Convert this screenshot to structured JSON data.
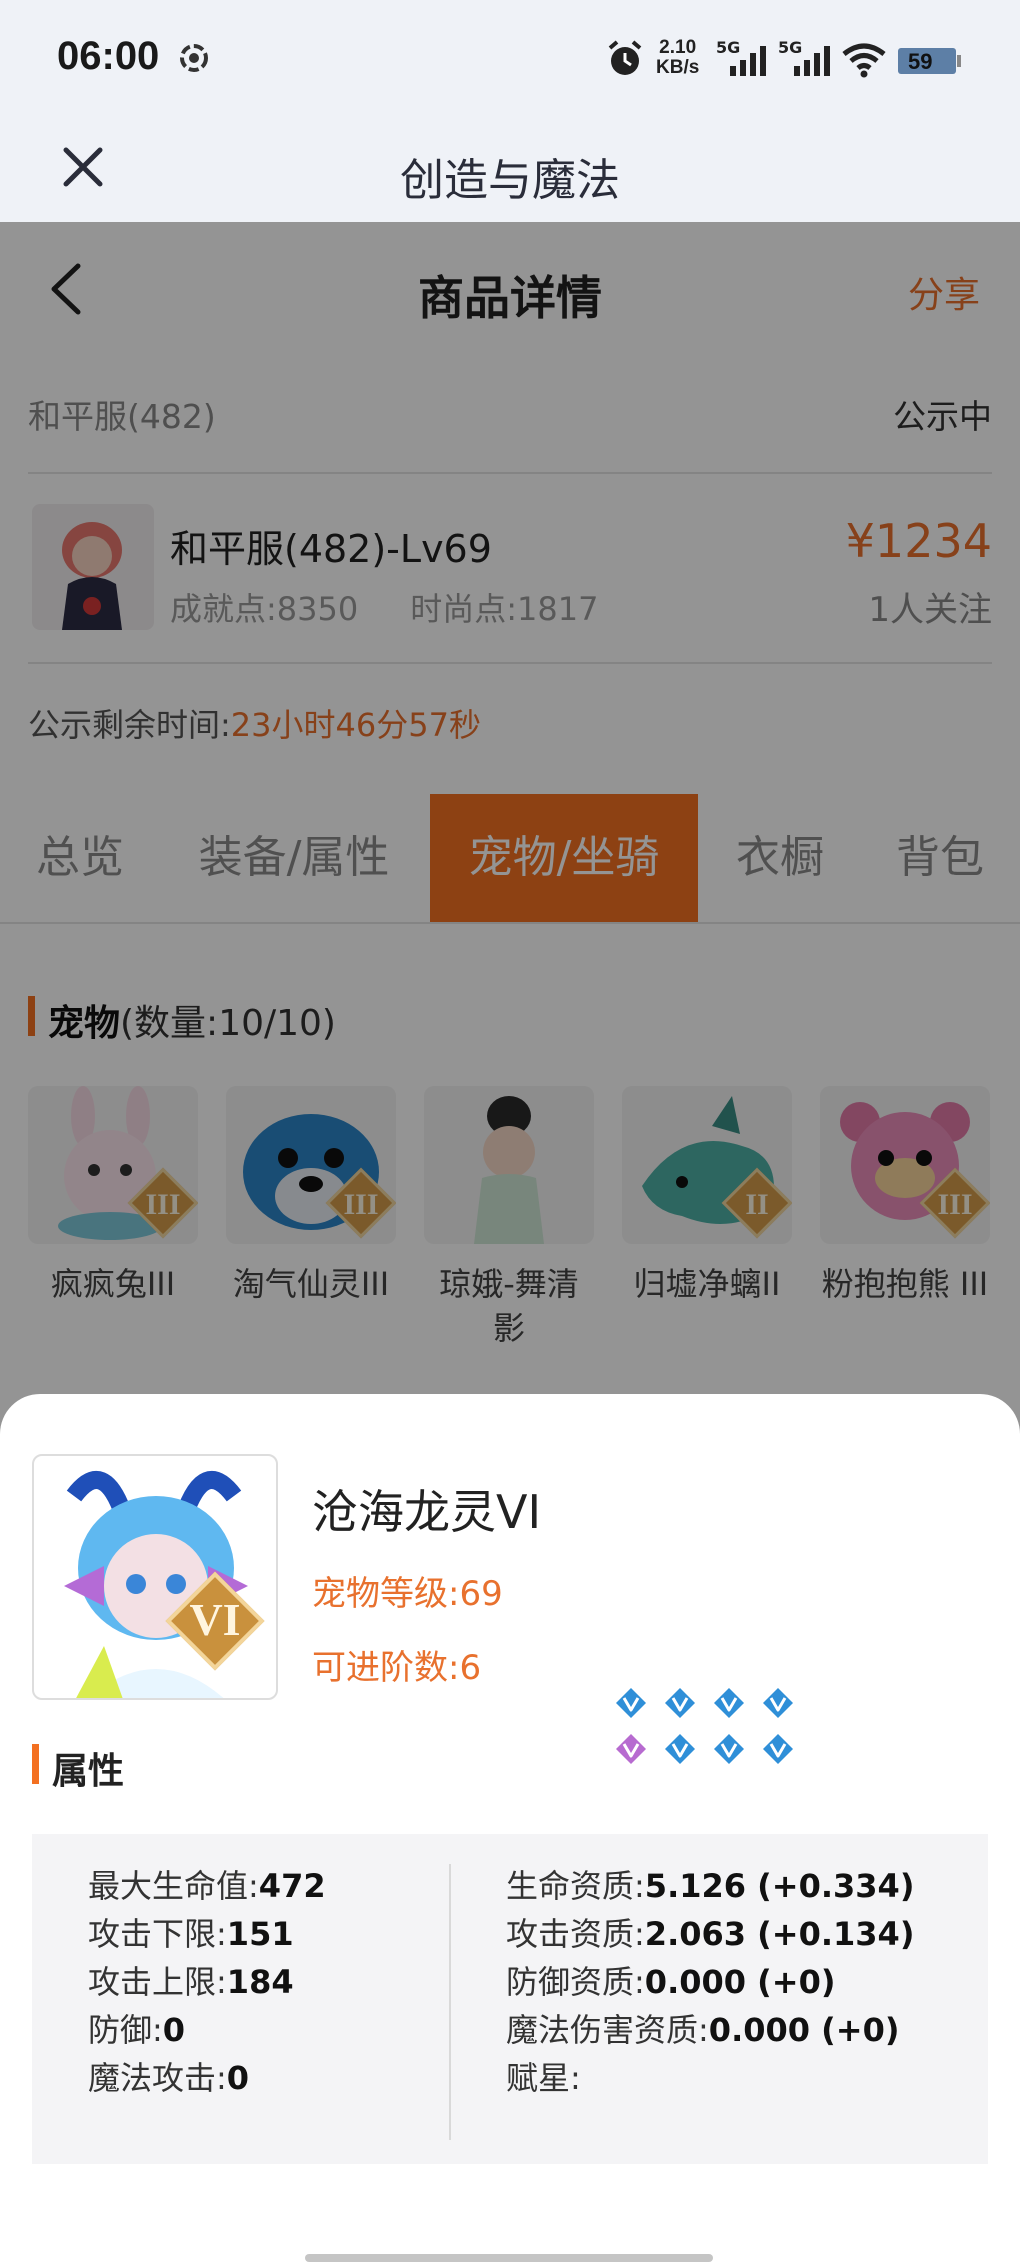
{
  "status_bar": {
    "time": "06:00",
    "net_speed_top": "2.10",
    "net_speed_unit": "KB/s",
    "sim1": "5G",
    "sim2": "5G",
    "battery": "59"
  },
  "app_bar": {
    "title": "创造与魔法",
    "close_icon": "close-icon"
  },
  "nav": {
    "title": "商品详情",
    "share": "分享",
    "back_icon": "chevron-left-icon"
  },
  "listing": {
    "server": "和平服(482)",
    "status": "公示中",
    "character_name": "和平服(482)-Lv69",
    "achievement": "成就点:8350",
    "fashion": "时尚点:1817",
    "price": "¥1234",
    "followers": "1人关注",
    "countdown_label": "公示剩余时间:",
    "countdown_value": "23小时46分57秒"
  },
  "tabs": [
    {
      "label": "总览",
      "active": false
    },
    {
      "label": "装备/属性",
      "active": false
    },
    {
      "label": "宠物/坐骑",
      "active": true
    },
    {
      "label": "衣橱",
      "active": false
    },
    {
      "label": "背包",
      "active": false
    }
  ],
  "pets_section": {
    "title": "宠物",
    "count": "(数量:10/10)"
  },
  "pets": [
    {
      "name": "疯疯兔III",
      "tier": "III"
    },
    {
      "name": "淘气仙灵III",
      "tier": "III"
    },
    {
      "name": "琼娥-舞清影",
      "tier": ""
    },
    {
      "name": "归墟净螭II",
      "tier": "II"
    },
    {
      "name": "粉抱抱熊 III",
      "tier": "III"
    }
  ],
  "sheet": {
    "pet_name": "沧海龙灵VI",
    "level": "宠物等级:69",
    "advance": "可进阶数:6",
    "tier": "VI",
    "attr_title": "属性",
    "left_attrs": [
      {
        "label": "最大生命值:",
        "value": "472"
      },
      {
        "label": "攻击下限:",
        "value": "151"
      },
      {
        "label": "攻击上限:",
        "value": "184"
      },
      {
        "label": "防御:",
        "value": "0"
      },
      {
        "label": "魔法攻击:",
        "value": "0"
      }
    ],
    "right_attrs": [
      {
        "label": "生命资质:",
        "value": "5.126 (+0.334)"
      },
      {
        "label": "攻击资质:",
        "value": "2.063 (+0.134)"
      },
      {
        "label": "防御资质:",
        "value": "0.000 (+0)"
      },
      {
        "label": "魔法伤害资质:",
        "value": "0.000 (+0)"
      },
      {
        "label": "赋星:",
        "value": ""
      }
    ],
    "stars": [
      "blue",
      "blue",
      "blue",
      "blue",
      "purple",
      "blue",
      "blue",
      "blue"
    ],
    "star_colors": {
      "blue": "#2f8fd8",
      "purple": "#b76bd0"
    }
  },
  "colors": {
    "accent": "#f37021",
    "accent_text": "#e8712e"
  }
}
